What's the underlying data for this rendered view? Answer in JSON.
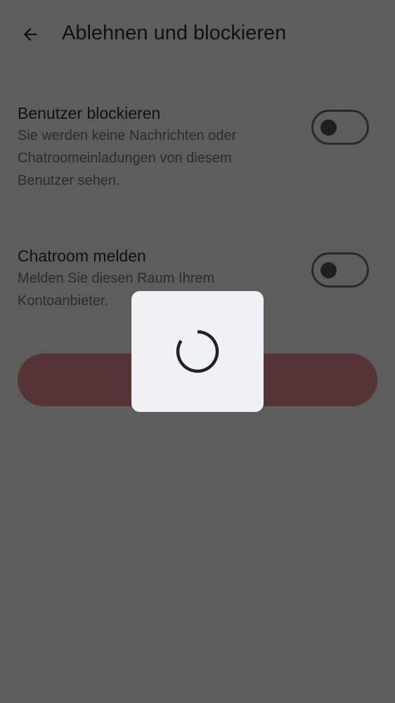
{
  "header": {
    "back_icon": "arrow-back-icon",
    "title": "Ablehnen und blockieren"
  },
  "settings": [
    {
      "title": "Benutzer blockieren",
      "description": "Sie werden keine Nachrichten oder Chatroomeinladungen von diesem Benutzer sehen.",
      "enabled": false
    },
    {
      "title": "Chatroom melden",
      "description": "Melden Sie diesen Raum Ihrem Kontoanbieter.",
      "enabled": false
    }
  ],
  "action": {
    "label": ""
  },
  "loading": {
    "spinner_icon": "progress-spinner-icon"
  },
  "colors": {
    "scrim_background": "#5d5d5d",
    "action_button": "#553436",
    "dialog_background": "#f0f1f5",
    "spinner": "#222222"
  }
}
